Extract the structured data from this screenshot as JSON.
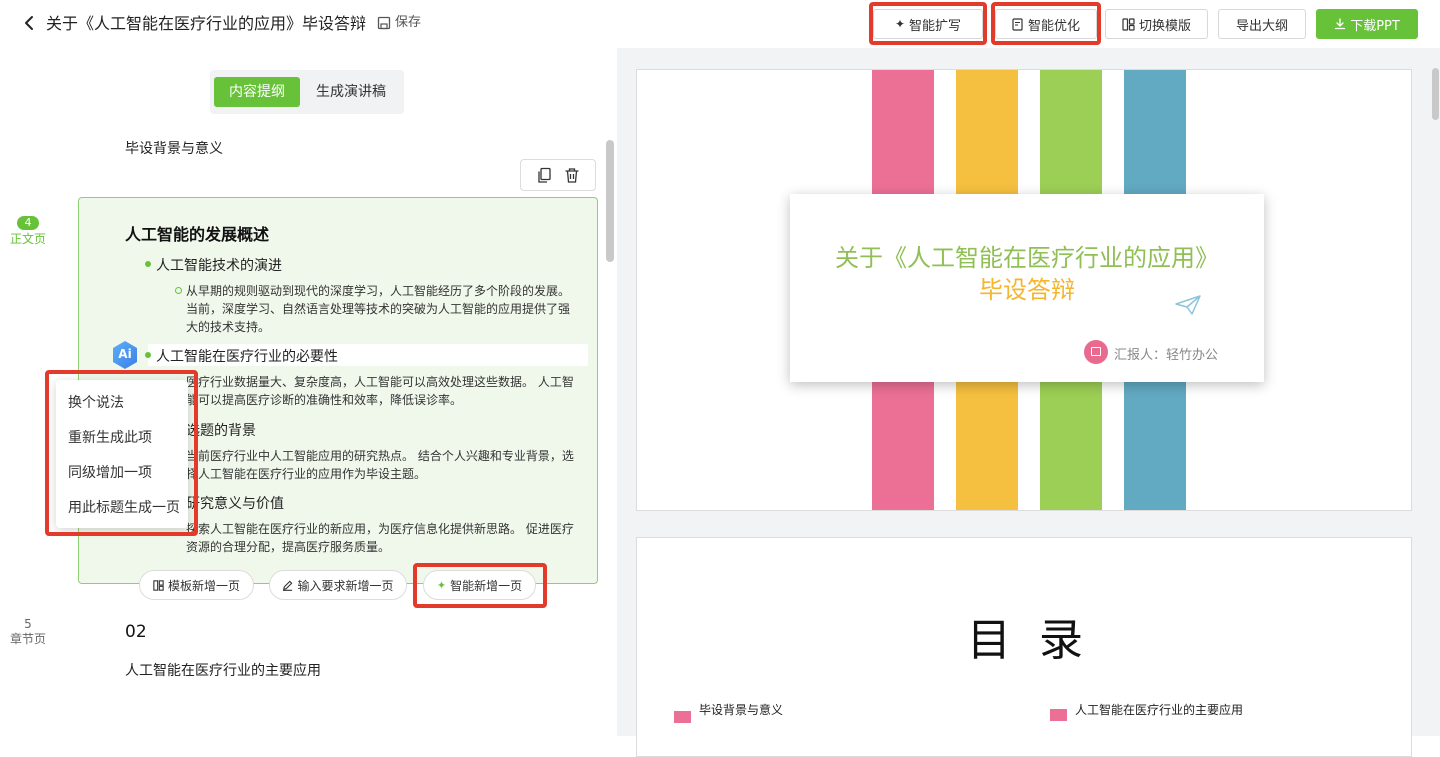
{
  "header": {
    "title": "关于《人工智能在医疗行业的应用》毕设答辩",
    "save_label": "保存",
    "buttons": {
      "expand": "智能扩写",
      "optimize": "智能优化",
      "switch_template": "切换模版",
      "export_outline": "导出大纲",
      "download": "下载PPT"
    }
  },
  "tabs": {
    "outline": "内容提纲",
    "speech": "生成演讲稿"
  },
  "outline": {
    "prev_item": "毕设背景与意义",
    "page4": {
      "num": "4",
      "type": "正文页"
    },
    "page5": {
      "num": "5",
      "type": "章节页"
    },
    "card": {
      "title": "人工智能的发展概述",
      "b1": "人工智能技术的演进",
      "b1_sub": "从早期的规则驱动到现代的深度学习，人工智能经历了多个阶段的发展。 当前，深度学习、自然语言处理等技术的突破为人工智能的应用提供了强大的技术支持。",
      "b2": "人工智能在医疗行业的必要性",
      "b2_sub": "医疗行业数据量大、复杂度高，人工智能可以高效处理这些数据。 人工智能可以提高医疗诊断的准确性和效率，降低误诊率。",
      "b3": "选题的背景",
      "b3_sub": "当前医疗行业中人工智能应用的研究热点。 结合个人兴趣和专业背景，选择人工智能在医疗行业的应用作为毕设主题。",
      "b4": "研究意义与价值",
      "b4_sub": "探索人工智能在医疗行业的新应用，为医疗信息化提供新思路。 促进医疗资源的合理分配，提高医疗服务质量。"
    },
    "ai_badge": "Ai",
    "context_menu": [
      "换个说法",
      "重新生成此项",
      "同级增加一项",
      "用此标题生成一页"
    ],
    "add_buttons": {
      "template": "模板新增一页",
      "prompt": "输入要求新增一页",
      "smart": "智能新增一页"
    },
    "section_number": "02",
    "section_title": "人工智能在医疗行业的主要应用"
  },
  "slides": {
    "cover": {
      "title_line1": "关于《人工智能在医疗行业的应用》",
      "title_line2": "毕设答辩",
      "presenter": "汇报人：轻竹办公",
      "colors": {
        "stripe1": "#ec7096",
        "stripe2": "#f5c040",
        "stripe3": "#9ccf55",
        "stripe4": "#62a9c2",
        "title1": "#8fbf55",
        "title2": "#f5b52d"
      }
    },
    "toc": {
      "title": "目  录",
      "items": [
        "毕设背景与意义",
        "人工智能在医疗行业的主要应用"
      ]
    }
  },
  "colors": {
    "accent": "#67c23a",
    "highlight_box": "#e23a2b"
  }
}
